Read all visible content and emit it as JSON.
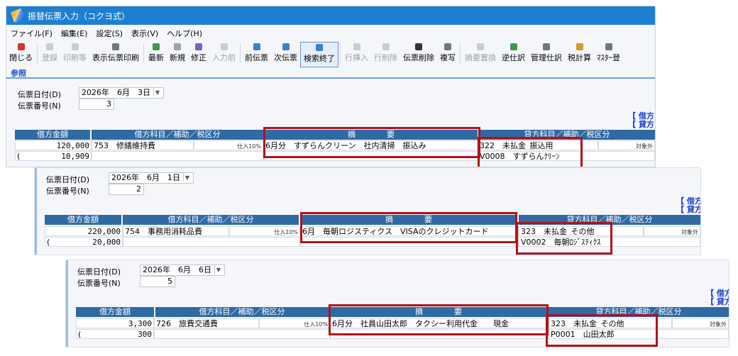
{
  "window": {
    "title": "振替伝票入力（コクヨ式）",
    "menu": [
      "ファイル(F)",
      "編集(E)",
      "設定(S)",
      "表示(V)",
      "ヘルプ(H)"
    ],
    "toolbar": [
      {
        "label": "閉じる",
        "icon": "close-icon",
        "color": "#d9342b",
        "state": "normal"
      },
      {
        "label": "登録",
        "icon": "save-icon",
        "color": "#c8cdd4",
        "state": "disabled"
      },
      {
        "label": "印刷等",
        "icon": "print-icon",
        "color": "#c8cdd4",
        "state": "disabled"
      },
      {
        "label": "表示伝票印刷",
        "icon": "print-icon",
        "color": "#6f7781",
        "state": "normal"
      },
      {
        "label": "最新",
        "icon": "refresh-icon",
        "color": "#3a9a4a",
        "state": "normal"
      },
      {
        "label": "新規",
        "icon": "new-document-icon",
        "color": "#9aa3ad",
        "state": "normal"
      },
      {
        "label": "修正",
        "icon": "edit-icon",
        "color": "#7b5ec8",
        "state": "normal"
      },
      {
        "label": "入力前",
        "icon": "back-icon",
        "color": "#c8cdd4",
        "state": "disabled"
      },
      {
        "label": "前伝票",
        "icon": "previous-icon",
        "color": "#3b7fd0",
        "state": "normal"
      },
      {
        "label": "次伝票",
        "icon": "next-icon",
        "color": "#3b7fd0",
        "state": "normal"
      },
      {
        "label": "検索終了",
        "icon": "search-icon",
        "color": "#3b7fd0",
        "state": "active"
      },
      {
        "label": "行挿入",
        "icon": "insert-row-icon",
        "color": "#c8cdd4",
        "state": "disabled"
      },
      {
        "label": "行削除",
        "icon": "delete-row-icon",
        "color": "#c8cdd4",
        "state": "disabled"
      },
      {
        "label": "伝票削除",
        "icon": "delete-icon",
        "color": "#333333",
        "state": "normal"
      },
      {
        "label": "複写",
        "icon": "copy-icon",
        "color": "#6f7781",
        "state": "normal"
      },
      {
        "label": "摘要置換",
        "icon": "replace-icon",
        "color": "#c8cdd4",
        "state": "disabled"
      },
      {
        "label": "逆仕訳",
        "icon": "reverse-icon",
        "color": "#3a9a4a",
        "state": "normal"
      },
      {
        "label": "管理仕訳",
        "icon": "ledger-icon",
        "color": "#6f7781",
        "state": "normal"
      },
      {
        "label": "税計算",
        "icon": "tax-icon",
        "color": "#d19a2b",
        "state": "normal"
      },
      {
        "label": "ﾏｽﾀｰ登",
        "icon": "master-icon",
        "color": "#6f7781",
        "state": "normal"
      }
    ],
    "tab_label": "参照",
    "date_label": "伝票日付(D)",
    "number_label": "伝票番号(N)",
    "bracket_debit": "【 借方",
    "bracket_credit": "【 貸方",
    "col_debit_amount": "借方金額",
    "col_debit_account": "借方科目／補助／税区分",
    "col_summary": "摘　　　　要",
    "col_credit_account": "貸方科目／補助／税区分",
    "tax_in": "仕入10%",
    "tax_out": "対象外"
  },
  "vouchers": [
    {
      "date": "2026年　6月　3日",
      "number": "3",
      "debit_amount": "120,000",
      "debit_tax_amount": "10,909",
      "debit_code": "753",
      "debit_name": "修繕維持費",
      "tax_prefix": "(",
      "summary": "6月分　すずらんクリーン　社内清掃　振込み",
      "credit_code": "322",
      "credit_name": "未払金_振込用",
      "credit_sub_code": "V0008",
      "credit_sub_name": "すずらんｸﾘｰﾝ"
    },
    {
      "date": "2026年　6月　1日",
      "number": "2",
      "debit_amount": "220,000",
      "debit_tax_amount": "20,000",
      "debit_code": "754",
      "debit_name": "事務用消耗品費",
      "tax_prefix": "(",
      "summary": "6月　毎朝ロジスティクス　VISAのクレジットカード",
      "credit_code": "323",
      "credit_name": "未払金_その他",
      "credit_sub_code": "V0002",
      "credit_sub_name": "毎朝ﾛｼﾞｽﾃｨｸｽ"
    },
    {
      "date": "2026年　6月　6日",
      "number": "5",
      "debit_amount": "3,300",
      "debit_tax_amount": "300",
      "debit_code": "726",
      "debit_name": "旅費交通費",
      "tax_prefix": "(",
      "summary": "6月分　社員山田太郎　タクシー利用代金　　現金",
      "credit_code": "323",
      "credit_name": "未払金_その他",
      "credit_sub_code": "P0001",
      "credit_sub_name": "山田太郎"
    }
  ],
  "colors": {
    "titlebar": "#1e7fd0",
    "grid_header": "#2f6aa3",
    "highlight": "#b3121a",
    "bracket": "#1a3ec8"
  }
}
